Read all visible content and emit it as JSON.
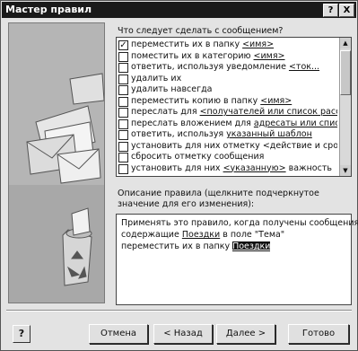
{
  "window": {
    "title": "Мастер правил",
    "help_glyph": "?",
    "close_glyph": "X"
  },
  "question": "Что следует сделать с сообщением?",
  "rules": [
    {
      "checked": true,
      "text": "переместить их в папку ",
      "link": "<имя>",
      "after": ""
    },
    {
      "checked": false,
      "text": "поместить их в категорию ",
      "link": "<имя>",
      "after": ""
    },
    {
      "checked": false,
      "text": "ответить, используя уведомление ",
      "link": "<ток...",
      "after": ""
    },
    {
      "checked": false,
      "text": "удалить их",
      "link": "",
      "after": ""
    },
    {
      "checked": false,
      "text": "удалить навсегда",
      "link": "",
      "after": ""
    },
    {
      "checked": false,
      "text": "переместить копию в папку ",
      "link": "<имя>",
      "after": ""
    },
    {
      "checked": false,
      "text": "переслать для ",
      "link": "<получателей или список рассы...",
      "after": ""
    },
    {
      "checked": false,
      "text": "переслать вложением для ",
      "link": "адресаты или спис...",
      "after": ""
    },
    {
      "checked": false,
      "text": "ответить, используя ",
      "link": "указанный шаблон",
      "after": ""
    },
    {
      "checked": false,
      "text": "установить для них отметку <действие и срок>",
      "link": "",
      "after": ""
    },
    {
      "checked": false,
      "text": "сбросить отметку сообщения",
      "link": "",
      "after": ""
    },
    {
      "checked": false,
      "text": "установить для них ",
      "link": "<указанную>",
      "after": " важность"
    }
  ],
  "description_label": "Описание правила (щелкните подчеркнутое значение для его изменения):",
  "description": {
    "line1": "Применять это правило, когда получены сообщения",
    "line2_pre": "содержащие ",
    "line2_link": "Поездки",
    "line2_post": " в поле \"Тема\"",
    "line3_pre": "переместить их в папку ",
    "line3_link": "Поездки"
  },
  "buttons": {
    "help": "?",
    "cancel": "Отмена",
    "back": "< Назад",
    "next": "Далее >",
    "finish": "Готово"
  },
  "icons": {
    "scroll_up": "up-arrow-icon",
    "scroll_down": "down-arrow-icon",
    "illustration": "recycle-bin-letters-illustration"
  }
}
